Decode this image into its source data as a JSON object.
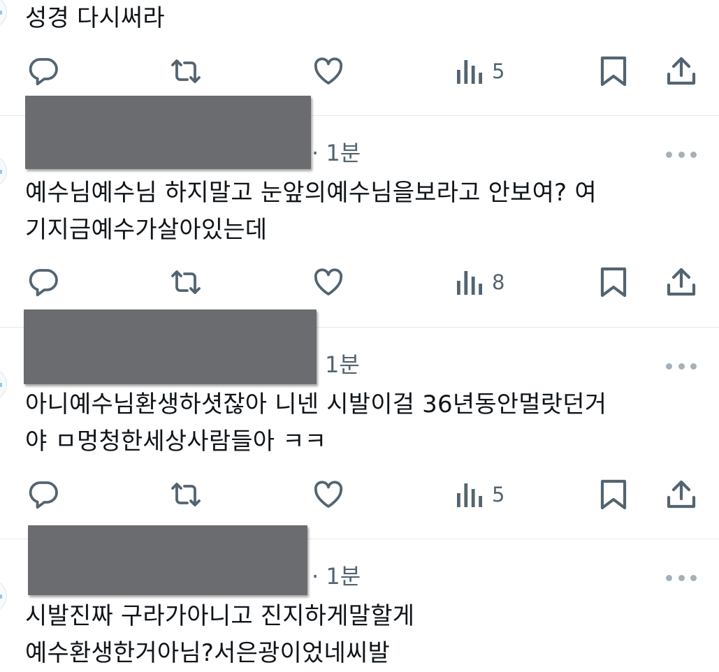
{
  "tweets": [
    {
      "text": "성경 다시써라",
      "time": "",
      "views": "5"
    },
    {
      "text": "예수님예수님 하지말고 눈앞의예수님을보라고 안보여? 여\n기지금예수가살아있는데",
      "time": "· 1분",
      "views": "8"
    },
    {
      "text": "아니예수님환생하셧잖아 니넨 시발이걸 36년동안멀랏던거\n야 ㅁ멍청한세상사람들아 ㅋㅋ",
      "time": "1분",
      "views": "5"
    },
    {
      "text": "시발진짜 구라가아니고 진지하게말할게\n예수환생한거아님?서은광이었네씨발",
      "time": "· 1분",
      "views": ""
    }
  ],
  "icons": {
    "reply": "reply-icon",
    "retweet": "retweet-icon",
    "like": "like-icon",
    "views": "views-icon",
    "bookmark": "bookmark-icon",
    "share": "share-icon",
    "more": "more-icon"
  },
  "colors": {
    "text": "#0f1419",
    "secondary": "#536471",
    "divider": "#e7e9ea",
    "redaction": "#6b6c6f"
  }
}
